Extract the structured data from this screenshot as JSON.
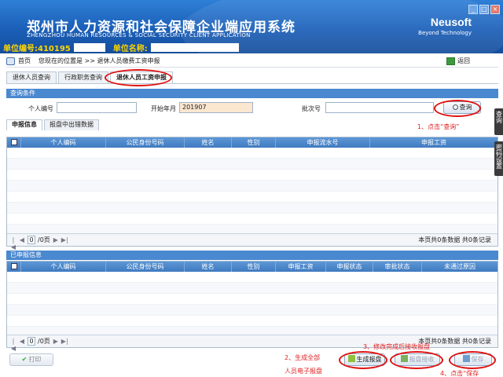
{
  "app": {
    "title_cn": "郑州市人力资源和社会保障企业端应用系统",
    "title_en": "ZHENGZHOU HUMAN RESOURCES & SOCIAL SECURITY CLIENT APPLICATION",
    "unit_code_label": "单位编号:410195",
    "unit_name_label": "单位名称:",
    "brand_name": "Neusoft",
    "brand_tagline": "Beyond Technology",
    "window_buttons": [
      "_",
      "□",
      "×"
    ]
  },
  "breadcrumb": {
    "home": "首页",
    "location": "您现在的位置是 >> 退休人员缴费工资申报",
    "back": "返回"
  },
  "tabs": [
    "退休人员查询",
    "行政职务查询",
    "退休人员工资申报"
  ],
  "query": {
    "header": "查询条件",
    "person_id_label": "个人编号",
    "start_month_label": "开始年月",
    "start_month_value": "201907",
    "batch_label": "批次号",
    "query_button": "查询"
  },
  "subtabs": [
    "申报信息",
    "报盘中出错数据"
  ],
  "grid1": {
    "columns": [
      "个人编码",
      "公民身份号码",
      "姓名",
      "性别",
      "申报流水号",
      "申报工资"
    ],
    "page_value": "0",
    "page_total": "/0页",
    "summary": "本页共0条数据 共0条记录"
  },
  "reported": {
    "header": "已申报信息",
    "columns": [
      "个人编码",
      "公民身份号码",
      "姓名",
      "性别",
      "申报工资",
      "申报状态",
      "审批状态",
      "未通过原因"
    ],
    "page_value": "0",
    "page_total": "/0页",
    "summary": "本页共0条数据 共0条记录"
  },
  "side_tabs": [
    "查询",
    "密码设置"
  ],
  "buttons": {
    "print": "打印",
    "generate": "生成报盘",
    "receive": "报盘接收",
    "save": "保存"
  },
  "annotations": {
    "a1": "1、点击“查询”",
    "a2_line1": "2、生成全部",
    "a2_line2": "人员电子报盘",
    "a3": "3、修改完成后接收报盘",
    "a4": "4、点击“保存"
  },
  "colors": {
    "header_blue": "#1b5fb8",
    "grid_header": "#4a88cf",
    "annotation_red": "#e02020",
    "date_field": "#fbe6d0"
  }
}
